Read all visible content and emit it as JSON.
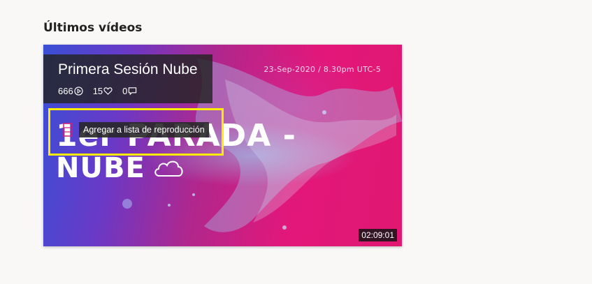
{
  "section": {
    "title": "Últimos vídeos"
  },
  "video": {
    "title": "Primera Sesión Nube",
    "views": "666",
    "likes": "15",
    "comments": "0",
    "date": "23-Sep-2020 / 8.30pm UTC-5",
    "thumb_line1": "1er PARADA -",
    "thumb_line2": "NUBE",
    "duration": "02:09:01",
    "tooltip": "Agregar a lista de reproducción"
  },
  "icons": {
    "views": "play-circle-icon",
    "likes": "heart-icon",
    "comments": "comment-icon",
    "playlist": "add-to-playlist-icon",
    "thumb_decor": "cloud-icon"
  },
  "colors": {
    "highlight": "#ffec00",
    "thumb_left": "#3a4fd6",
    "thumb_right": "#e2177a"
  }
}
